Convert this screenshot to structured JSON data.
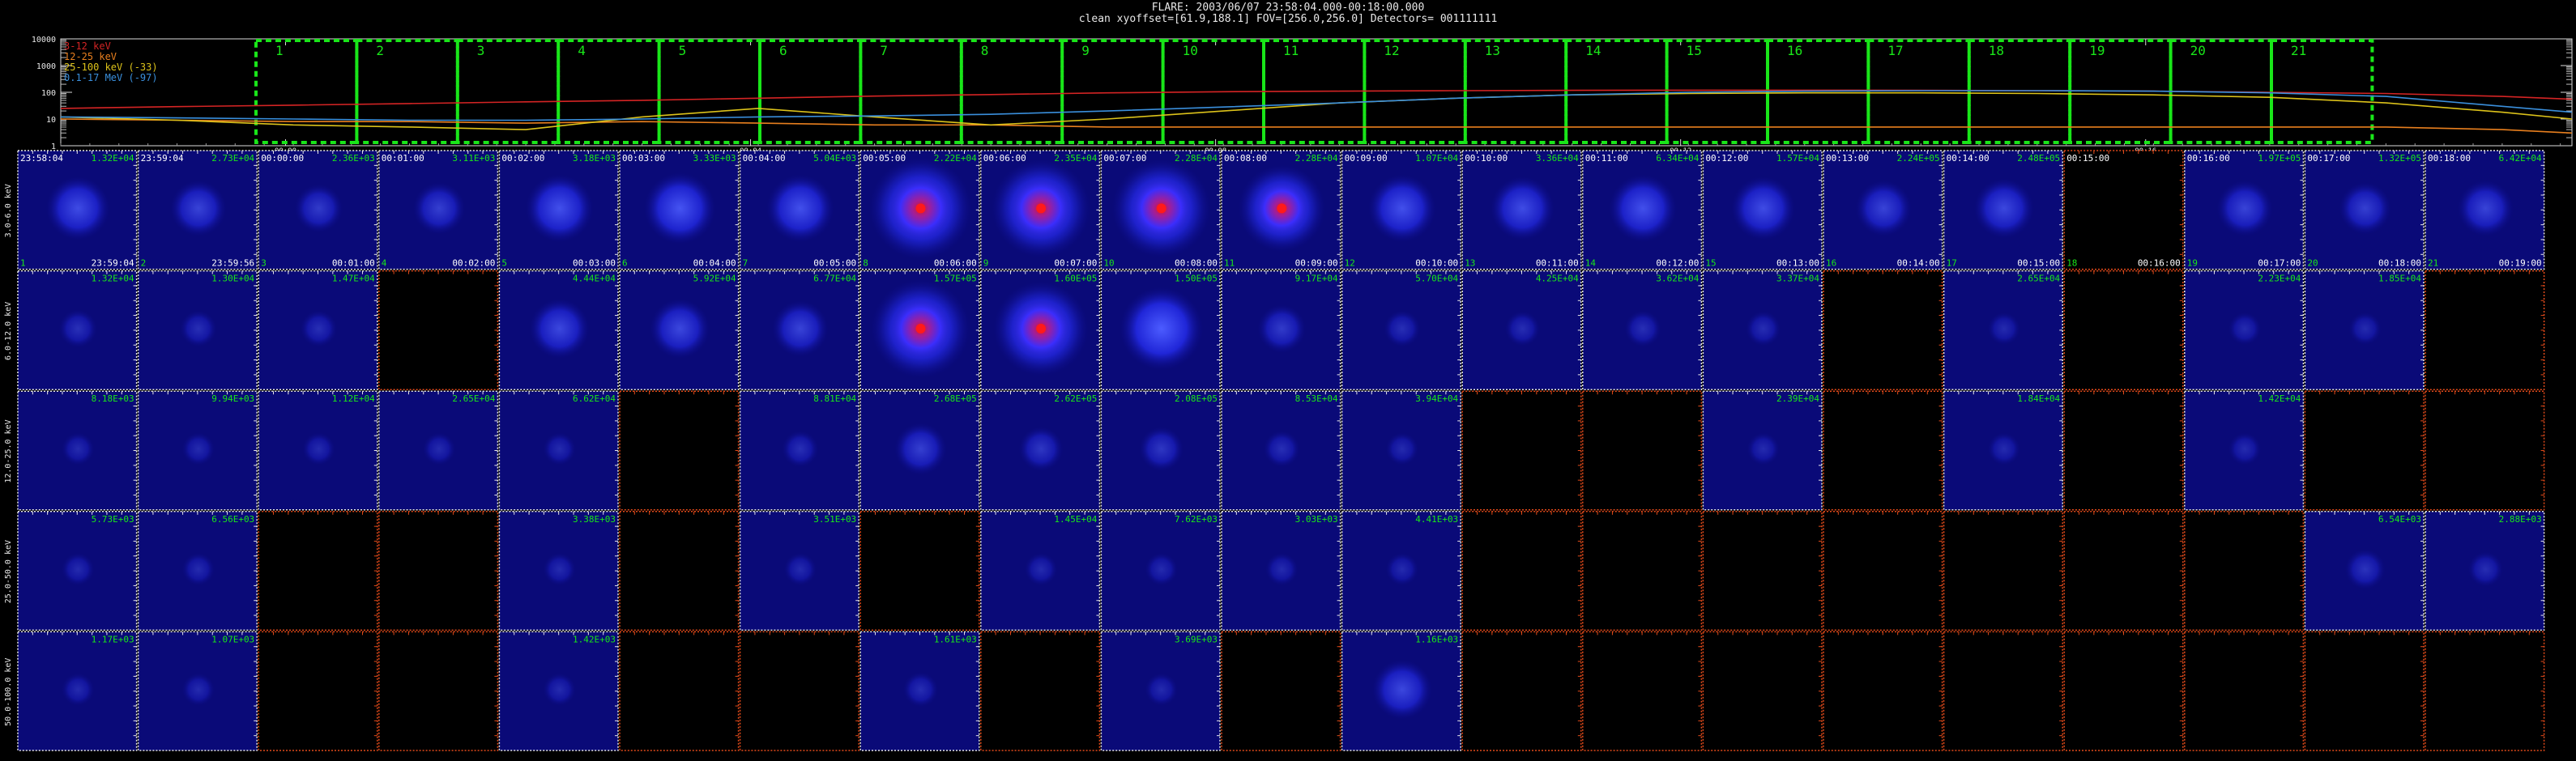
{
  "header": {
    "title": "FLARE: 2003/06/07 23:58:04.000-00:18:00.000",
    "info": "clean    xyoffset=[61.9,188.1]   FOV=[256.0,256.0]    Detectors= 001111111"
  },
  "colors": {
    "panel_border": "#e8e8e8",
    "empty_border": "#e24a1a",
    "interval_box": "#19e619",
    "label_green": "#19e619",
    "label_white": "#ffffff"
  },
  "chart_data": [
    {
      "type": "line",
      "title": "",
      "xlabel": "",
      "ylabel": "",
      "yscale": "log",
      "ylim": [
        1,
        10000
      ],
      "yticks": [
        "10000",
        "1000",
        "100",
        "10",
        "1"
      ],
      "xlim_minutes_from_start": [
        0,
        21.6
      ],
      "xticks": [
        "00:00",
        "00:04",
        "00:08",
        "00:12",
        "00:16",
        "00:20"
      ],
      "legend": [
        "3-12 keV",
        "12-25 keV",
        "25-100 keV (-33)",
        "0.1-17 MeV (-97)"
      ],
      "legend_position": "top-left",
      "series": [
        {
          "name": "3-12 keV",
          "color": "#d42424",
          "x": [
            0,
            1,
            2,
            3,
            4,
            5,
            6,
            7,
            8,
            9,
            10,
            11,
            12,
            13,
            14,
            15,
            16,
            17,
            18,
            19,
            20,
            21,
            21.6
          ],
          "values": [
            25,
            29,
            33,
            38,
            44,
            50,
            60,
            72,
            82,
            95,
            105,
            110,
            115,
            118,
            120,
            120,
            118,
            115,
            110,
            100,
            90,
            70,
            55
          ]
        },
        {
          "name": "12-25 keV",
          "color": "#e87f1e",
          "x": [
            0,
            1,
            2,
            3,
            4,
            5,
            6,
            7,
            8,
            9,
            10,
            11,
            12,
            13,
            14,
            15,
            16,
            17,
            18,
            19,
            20,
            21,
            21.6
          ],
          "values": [
            10,
            9,
            8,
            8,
            7,
            8,
            7,
            6,
            6,
            5,
            5,
            5,
            5,
            5,
            5,
            5,
            5,
            5,
            5,
            5,
            5,
            4,
            3
          ]
        },
        {
          "name": "25-100 keV (-33)",
          "color": "#dcc21a",
          "x": [
            0,
            1,
            2,
            3,
            4,
            5,
            6,
            7,
            8,
            9,
            10,
            11,
            12,
            13,
            14,
            15,
            16,
            17,
            18,
            19,
            20,
            21,
            21.6
          ],
          "values": [
            12,
            9,
            6,
            5,
            4,
            12,
            25,
            12,
            6,
            10,
            20,
            40,
            60,
            80,
            90,
            95,
            95,
            90,
            80,
            65,
            40,
            18,
            10
          ]
        },
        {
          "name": "0.1-17 MeV (-97)",
          "color": "#3a8fdc",
          "x": [
            0,
            1,
            2,
            3,
            4,
            5,
            6,
            7,
            8,
            9,
            10,
            11,
            12,
            13,
            14,
            15,
            16,
            17,
            18,
            19,
            20,
            21,
            21.6
          ],
          "values": [
            12,
            11,
            10,
            9,
            9,
            10,
            12,
            13,
            15,
            20,
            28,
            40,
            60,
            80,
            100,
            110,
            115,
            115,
            110,
            95,
            70,
            30,
            18
          ]
        }
      ],
      "intervals": [
        "1",
        "2",
        "3",
        "4",
        "5",
        "6",
        "7",
        "8",
        "9",
        "10",
        "11",
        "12",
        "13",
        "14",
        "15",
        "16",
        "17",
        "18",
        "19",
        "20",
        "21"
      ]
    },
    {
      "type": "heatmap",
      "title": "",
      "energy_bands": [
        "3.0-6.0 keV",
        "6.0-12.0 keV",
        "12.0-25.0 keV",
        "25.0-50.0 keV",
        "50.0-100.0 keV"
      ],
      "interval_numbers": [
        "1",
        "2",
        "3",
        "4",
        "5",
        "6",
        "7",
        "8",
        "9",
        "10",
        "11",
        "12",
        "13",
        "14",
        "15",
        "16",
        "17",
        "18",
        "19",
        "20",
        "21"
      ],
      "start_times": [
        "23:58:04",
        "23:59:04",
        "00:00:00",
        "00:01:00",
        "00:02:00",
        "00:03:00",
        "00:04:00",
        "00:05:00",
        "00:06:00",
        "00:07:00",
        "00:08:00",
        "00:09:00",
        "00:10:00",
        "00:11:00",
        "00:12:00",
        "00:13:00",
        "00:14:00",
        "00:15:00",
        "00:16:00",
        "00:17:00",
        "00:18:00"
      ],
      "end_times": [
        "23:59:04",
        "23:59:56",
        "00:01:00",
        "00:02:00",
        "00:03:00",
        "00:04:00",
        "00:05:00",
        "00:06:00",
        "00:07:00",
        "00:08:00",
        "00:09:00",
        "00:10:00",
        "00:11:00",
        "00:12:00",
        "00:13:00",
        "00:14:00",
        "00:15:00",
        "00:16:00",
        "00:17:00",
        "00:18:00",
        "00:19:00"
      ],
      "peak_values": [
        [
          "1.32E+04",
          "2.73E+04",
          "2.36E+03",
          "3.11E+03",
          "3.18E+03",
          "3.33E+03",
          "5.04E+03",
          "2.22E+04",
          "2.35E+04",
          "2.28E+04",
          "2.28E+04",
          "1.07E+04",
          "3.36E+04",
          "6.34E+04",
          "1.57E+04",
          "2.24E+05",
          "2.48E+05",
          "",
          "1.97E+05",
          "1.32E+05",
          "6.42E+04"
        ],
        [
          "1.32E+04",
          "1.30E+04",
          "1.47E+04",
          "",
          "4.44E+04",
          "5.92E+04",
          "6.77E+04",
          "1.57E+05",
          "1.60E+05",
          "1.50E+05",
          "9.17E+04",
          "5.70E+04",
          "4.25E+04",
          "3.62E+04",
          "3.37E+04",
          "",
          "2.65E+04",
          "",
          "2.23E+04",
          "1.85E+04",
          ""
        ],
        [
          "8.18E+03",
          "9.94E+03",
          "1.12E+04",
          "2.65E+04",
          "6.62E+04",
          "",
          "8.81E+04",
          "2.68E+05",
          "2.62E+05",
          "2.08E+05",
          "8.53E+04",
          "3.94E+04",
          "",
          "",
          "2.39E+04",
          "",
          "1.84E+04",
          "",
          "1.42E+04",
          "",
          ""
        ],
        [
          "5.73E+03",
          "6.56E+03",
          "",
          "",
          "3.38E+03",
          "",
          "3.51E+03",
          "",
          "1.45E+04",
          "7.62E+03",
          "3.03E+03",
          "4.41E+03",
          "",
          "",
          "",
          "",
          "",
          "",
          "",
          "6.54E+03",
          "2.88E+03"
        ],
        [
          "1.17E+03",
          "1.07E+03",
          "",
          "",
          "1.42E+03",
          "",
          "",
          "1.61E+03",
          "",
          "3.69E+03",
          "",
          "1.16E+03",
          "",
          "",
          "",
          "",
          "",
          "",
          "",
          "",
          ""
        ]
      ],
      "empty_panels": [
        [
          false,
          false,
          false,
          false,
          false,
          false,
          false,
          false,
          false,
          false,
          false,
          false,
          false,
          false,
          false,
          false,
          false,
          true,
          false,
          false,
          false
        ],
        [
          false,
          false,
          false,
          true,
          false,
          false,
          false,
          false,
          false,
          false,
          false,
          false,
          false,
          false,
          false,
          true,
          false,
          true,
          false,
          false,
          true
        ],
        [
          false,
          false,
          false,
          false,
          false,
          true,
          false,
          false,
          false,
          false,
          false,
          false,
          true,
          true,
          false,
          true,
          false,
          true,
          false,
          true,
          true
        ],
        [
          false,
          false,
          true,
          true,
          false,
          true,
          false,
          true,
          false,
          false,
          false,
          false,
          true,
          true,
          true,
          true,
          true,
          true,
          true,
          false,
          false
        ],
        [
          false,
          false,
          true,
          true,
          false,
          true,
          true,
          false,
          true,
          false,
          true,
          false,
          true,
          true,
          true,
          true,
          true,
          true,
          true,
          true,
          true
        ]
      ],
      "source_intensity": [
        [
          0.45,
          0.35,
          0.25,
          0.3,
          0.5,
          0.55,
          0.5,
          0.95,
          0.9,
          0.9,
          0.75,
          0.5,
          0.45,
          0.5,
          0.45,
          0.35,
          0.4,
          0,
          0.35,
          0.3,
          0.35
        ],
        [
          0.12,
          0.1,
          0.1,
          0,
          0.4,
          0.4,
          0.35,
          0.9,
          0.85,
          0.7,
          0.25,
          0.1,
          0.08,
          0.1,
          0.08,
          0,
          0.05,
          0,
          0.05,
          0.05,
          0
        ],
        [
          0.05,
          0.05,
          0.05,
          0.05,
          0.05,
          0,
          0.1,
          0.3,
          0.2,
          0.2,
          0.1,
          0.05,
          0,
          0,
          0.05,
          0,
          0.05,
          0,
          0.05,
          0,
          0
        ],
        [
          0.05,
          0.05,
          0,
          0,
          0.05,
          0,
          0.05,
          0,
          0.05,
          0.05,
          0.05,
          0.05,
          0,
          0,
          0,
          0,
          0,
          0,
          0,
          0.15,
          0.08
        ],
        [
          0.05,
          0.05,
          0,
          0,
          0.05,
          0,
          0,
          0.08,
          0,
          0.05,
          0,
          0.4,
          0,
          0,
          0,
          0,
          0,
          0,
          0,
          0,
          0
        ]
      ]
    }
  ]
}
